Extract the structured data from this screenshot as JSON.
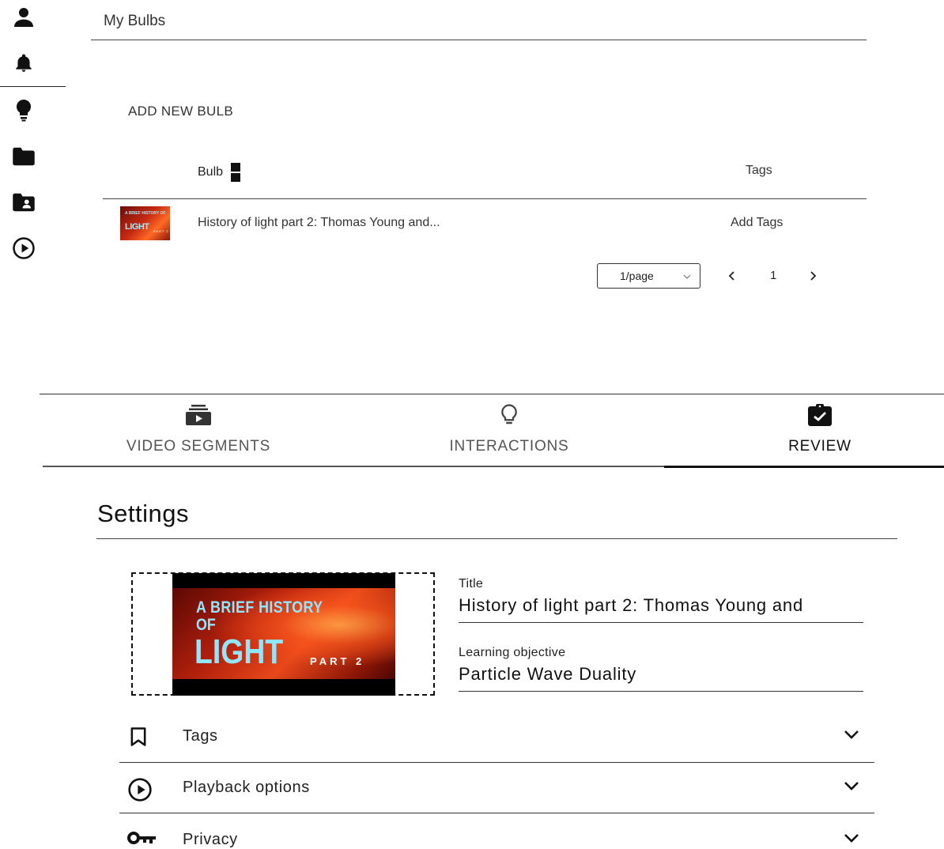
{
  "sidebar": {
    "icons": [
      "person-icon",
      "bell-icon",
      "bulb-icon",
      "folder-icon",
      "shared-folder-icon",
      "play-circle-icon"
    ]
  },
  "bulbs": {
    "title": "My Bulbs",
    "add_new_label": "ADD NEW BULB",
    "columns": {
      "bulb": "Bulb",
      "tags": "Tags"
    },
    "rows": [
      {
        "title": "History of light part 2: Thomas Young and...",
        "tags_action": "Add Tags",
        "thumbnail": {
          "line1": "A BRIEF HISTORY OF",
          "line2": "LIGHT",
          "line3": "PART 2"
        }
      }
    ],
    "pagination": {
      "page_size": "1/page",
      "current_page": "1"
    }
  },
  "editor": {
    "tabs": [
      {
        "label": "VIDEO SEGMENTS",
        "icon": "video-stack-icon",
        "active": false
      },
      {
        "label": "INTERACTIONS",
        "icon": "bulb-outline-icon",
        "active": false
      },
      {
        "label": "REVIEW",
        "icon": "clipboard-check-icon",
        "active": true
      }
    ],
    "settings": {
      "heading": "Settings",
      "thumbnail": {
        "line1": "A BRIEF HISTORY",
        "line2": "OF",
        "line3": "LIGHT",
        "line4": "PART 2"
      },
      "title_label": "Title",
      "title_value": "History of light part 2: Thomas Young and",
      "objective_label": "Learning objective",
      "objective_value": "Particle Wave Duality",
      "sections": [
        {
          "label": "Tags",
          "icon": "bookmark-icon"
        },
        {
          "label": "Playback options",
          "icon": "play-circle-icon"
        },
        {
          "label": "Privacy",
          "icon": "key-icon"
        }
      ]
    }
  }
}
